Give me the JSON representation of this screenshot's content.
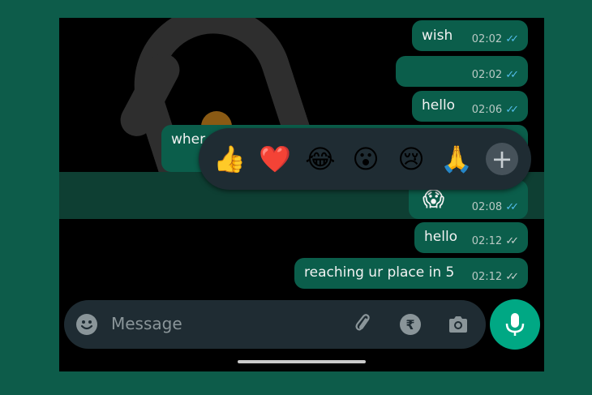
{
  "messages": [
    {
      "text": "wish",
      "time": "02:02",
      "status": "read"
    },
    {
      "text": "",
      "time": "02:02",
      "status": "read"
    },
    {
      "text": "hello",
      "time": "02:06",
      "status": "read"
    },
    {
      "text": "wher",
      "time": "",
      "status": ""
    },
    {
      "text": "",
      "time": "02:08",
      "status": "read",
      "sticker": "😱"
    },
    {
      "text": "hello",
      "time": "02:12",
      "status": "sent"
    },
    {
      "text": "reaching ur place in 5",
      "time": "02:12",
      "status": "sent"
    }
  ],
  "reactions": [
    "👍",
    "❤️",
    "😂",
    "😮",
    "😢",
    "🙏"
  ],
  "reaction_more": "+",
  "composer": {
    "placeholder": "Message"
  },
  "colors": {
    "bubble": "#0b5e4b",
    "accent": "#00a884",
    "read_tick": "#53bdeb",
    "panel": "#1f2c33"
  },
  "icons": {
    "emoji": "smiley-icon",
    "attach": "paperclip-icon",
    "payment": "rupee-icon",
    "camera": "camera-icon",
    "mic": "microphone-icon"
  }
}
